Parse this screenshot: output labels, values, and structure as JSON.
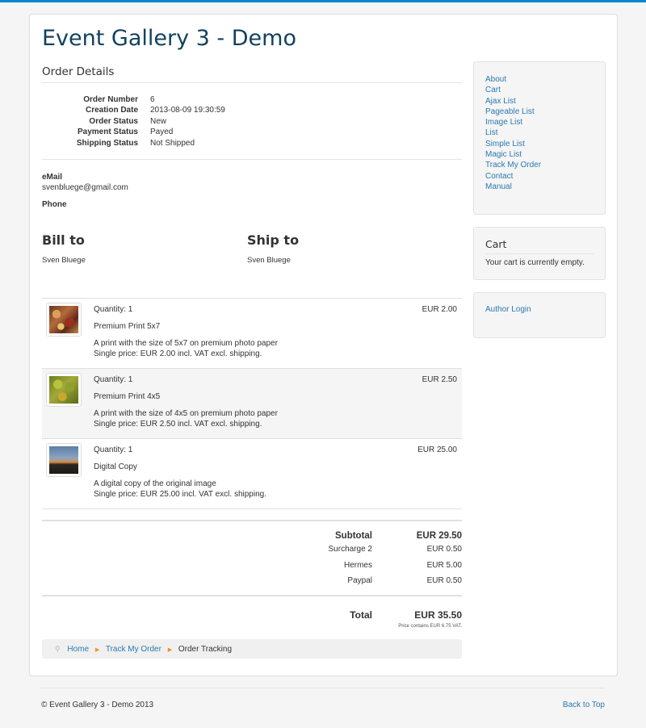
{
  "site": {
    "title": "Event Gallery 3 - Demo"
  },
  "page": {
    "heading": "Order Details"
  },
  "order": {
    "rows": [
      {
        "label": "Order Number",
        "value": "6"
      },
      {
        "label": "Creation Date",
        "value": "2013-08-09 19:30:59"
      },
      {
        "label": "Order Status",
        "value": "New"
      },
      {
        "label": "Payment Status",
        "value": "Payed"
      },
      {
        "label": "Shipping Status",
        "value": "Not Shipped"
      }
    ]
  },
  "contact": {
    "email_label": "eMail",
    "email": "svenbluege@gmail.com",
    "phone_label": "Phone"
  },
  "bill": {
    "heading": "Bill to",
    "name": "Sven Bluege"
  },
  "ship": {
    "heading": "Ship to",
    "name": "Sven Bluege"
  },
  "items": [
    {
      "quantity": "Quantity: 1",
      "name": "Premium Print 5x7",
      "desc1": "A print with the size of 5x7 on premium photo paper",
      "desc2": "Single price: EUR 2.00 incl. VAT excl. shipping.",
      "price": "EUR 2.00"
    },
    {
      "quantity": "Quantity: 1",
      "name": "Premium Print 4x5",
      "desc1": "A print with the size of 4x5 on premium photo paper",
      "desc2": "Single price: EUR 2.50 incl. VAT excl. shipping.",
      "price": "EUR 2.50"
    },
    {
      "quantity": "Quantity: 1",
      "name": "Digital Copy",
      "desc1": "A digital copy of the original image",
      "desc2": "Single price: EUR 25.00 incl. VAT excl. shipping.",
      "price": "EUR 25.00"
    }
  ],
  "totals": {
    "subtotal_label": "Subtotal",
    "subtotal": "EUR 29.50",
    "fees": [
      {
        "label": "Surcharge 2",
        "value": "EUR 0.50"
      },
      {
        "label": "Hermes",
        "value": "EUR 5.00"
      },
      {
        "label": "Paypal",
        "value": "EUR 0.50"
      }
    ],
    "total_label": "Total",
    "total": "EUR 35.50",
    "vat_note": "Price contains EUR 6.75 VAT."
  },
  "breadcrumb": {
    "home": "Home",
    "track": "Track My Order",
    "current": "Order Tracking"
  },
  "sidebar": {
    "menu": [
      "About",
      "Cart",
      "Ajax List",
      "Pageable List",
      "Image List",
      "List",
      "Simple List",
      "Magic List",
      "Track My Order",
      "Contact",
      "Manual"
    ],
    "cart_heading": "Cart",
    "cart_text": "Your cart is currently empty.",
    "author_login": "Author Login"
  },
  "footer": {
    "copyright": "© Event Gallery 3 - Demo 2013",
    "back_to_top": "Back to Top"
  },
  "colors": {
    "accent": "#0088cc",
    "title": "#12425d",
    "link": "#2a7ab0"
  },
  "icons": {
    "breadcrumb": "map-pin-icon",
    "separator": "triangle-right-icon"
  }
}
